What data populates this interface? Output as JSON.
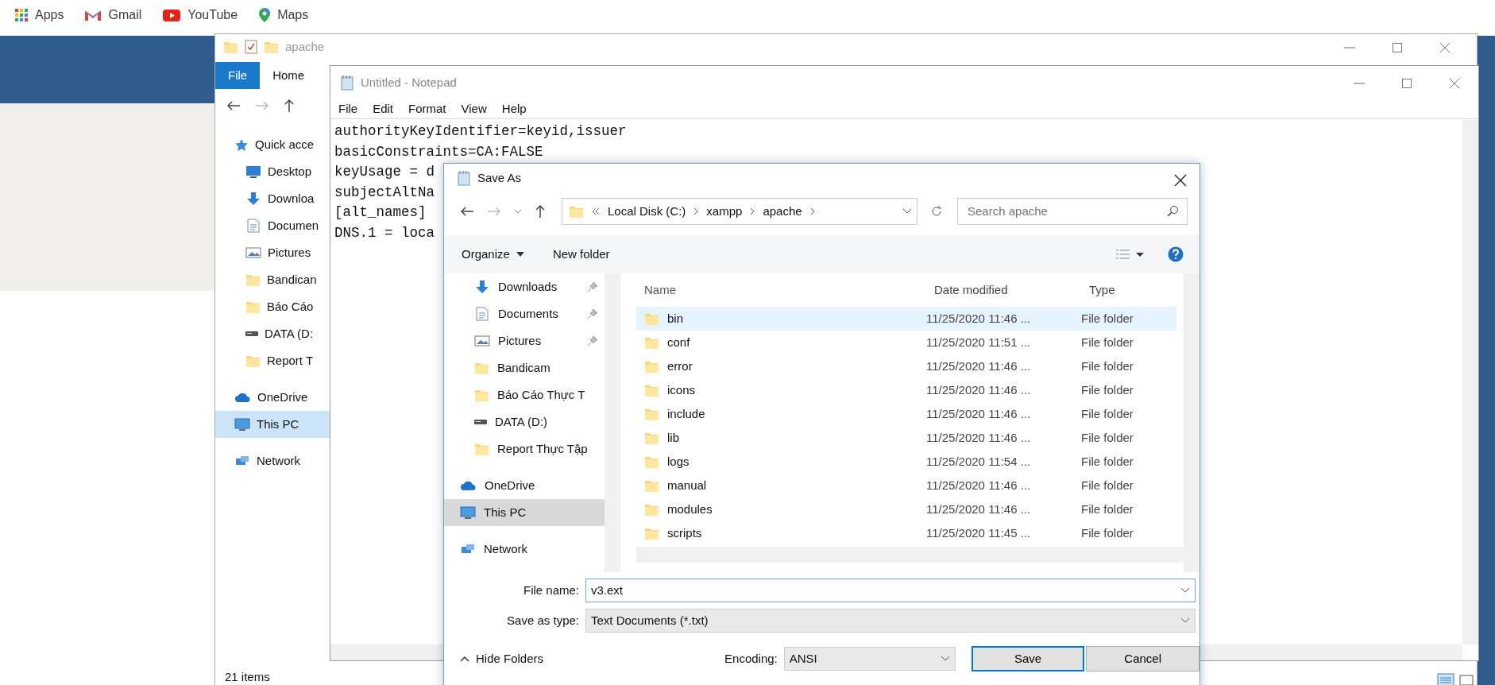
{
  "bookmarks": [
    {
      "label": "Apps",
      "kind": "apps"
    },
    {
      "label": "Gmail",
      "kind": "mail"
    },
    {
      "label": "YouTube",
      "kind": "video"
    },
    {
      "label": "Maps",
      "kind": "pin"
    }
  ],
  "explorer": {
    "title": "apache",
    "ribbon_tabs": [
      {
        "label": "File",
        "selected": true
      },
      {
        "label": "Home",
        "selected": false
      }
    ],
    "nav": [
      {
        "label": "Quick acce",
        "kind": "star",
        "selected": false
      },
      {
        "label": "Desktop",
        "kind": "desktop",
        "selected": false
      },
      {
        "label": "Downloa",
        "kind": "download",
        "selected": false
      },
      {
        "label": "Documen",
        "kind": "document",
        "selected": false
      },
      {
        "label": "Pictures",
        "kind": "picture",
        "selected": false
      },
      {
        "label": "Bandican",
        "kind": "folder",
        "selected": false
      },
      {
        "label": "Báo Cáo",
        "kind": "folder",
        "selected": false
      },
      {
        "label": "DATA (D:",
        "kind": "drive",
        "selected": false
      },
      {
        "label": "Report T",
        "kind": "folder",
        "selected": false
      },
      {
        "label": "OneDrive",
        "kind": "cloud",
        "selected": false
      },
      {
        "label": "This PC",
        "kind": "pc",
        "selected": true
      },
      {
        "label": "Network",
        "kind": "network",
        "selected": false
      }
    ],
    "status": "21 items"
  },
  "notepad": {
    "title": "Untitled - Notepad",
    "menu": [
      "File",
      "Edit",
      "Format",
      "View",
      "Help"
    ],
    "lines": [
      "authorityKeyIdentifier=keyid,issuer",
      "basicConstraints=CA:FALSE",
      "keyUsage = d",
      "subjectAltNa",
      "[alt_names]",
      "DNS.1 = loca"
    ]
  },
  "dialog": {
    "title": "Save As",
    "address": [
      "Local Disk (C:)",
      "xampp",
      "apache"
    ],
    "search": {
      "placeholder": "Search apache"
    },
    "toolbar": [
      "Organize",
      "New folder"
    ],
    "nav": [
      {
        "label": "Downloads",
        "kind": "download",
        "pinned": true,
        "selected": false
      },
      {
        "label": "Documents",
        "kind": "document",
        "pinned": true,
        "selected": false
      },
      {
        "label": "Pictures",
        "kind": "picture",
        "pinned": true,
        "selected": false
      },
      {
        "label": "Bandicam",
        "kind": "folder",
        "pinned": false,
        "selected": false
      },
      {
        "label": "Báo Cáo Thực T",
        "kind": "folder",
        "pinned": false,
        "selected": false
      },
      {
        "label": "DATA (D:)",
        "kind": "drive",
        "pinned": false,
        "selected": false
      },
      {
        "label": "Report Thực Tập",
        "kind": "folder",
        "pinned": false,
        "selected": false
      },
      {
        "label": "OneDrive",
        "kind": "cloud",
        "pinned": false,
        "selected": false
      },
      {
        "label": "This PC",
        "kind": "pc",
        "pinned": false,
        "selected": true
      },
      {
        "label": "Network",
        "kind": "network",
        "pinned": false,
        "selected": false
      }
    ],
    "columns": [
      "Name",
      "Date modified",
      "Type"
    ],
    "files": [
      {
        "name": "bin",
        "date": "11/25/2020 11:46 ...",
        "type": "File folder",
        "selected": true
      },
      {
        "name": "conf",
        "date": "11/25/2020 11:51 ...",
        "type": "File folder",
        "selected": false
      },
      {
        "name": "error",
        "date": "11/25/2020 11:46 ...",
        "type": "File folder",
        "selected": false
      },
      {
        "name": "icons",
        "date": "11/25/2020 11:46 ...",
        "type": "File folder",
        "selected": false
      },
      {
        "name": "include",
        "date": "11/25/2020 11:46 ...",
        "type": "File folder",
        "selected": false
      },
      {
        "name": "lib",
        "date": "11/25/2020 11:46 ...",
        "type": "File folder",
        "selected": false
      },
      {
        "name": "logs",
        "date": "11/25/2020 11:54 ...",
        "type": "File folder",
        "selected": false
      },
      {
        "name": "manual",
        "date": "11/25/2020 11:46 ...",
        "type": "File folder",
        "selected": false
      },
      {
        "name": "modules",
        "date": "11/25/2020 11:46 ...",
        "type": "File folder",
        "selected": false
      },
      {
        "name": "scripts",
        "date": "11/25/2020 11:45 ...",
        "type": "File folder",
        "selected": false
      }
    ],
    "file_name": {
      "label": "File name:",
      "value": "v3.ext"
    },
    "save_as_type": {
      "label": "Save as type:",
      "value": "Text Documents (*.txt)"
    },
    "hide_folders": "Hide Folders",
    "encoding": {
      "label": "Encoding:",
      "value": "ANSI"
    },
    "buttons": [
      {
        "label": "Save",
        "kind": "default"
      },
      {
        "label": "Cancel",
        "kind": "normal"
      }
    ]
  }
}
